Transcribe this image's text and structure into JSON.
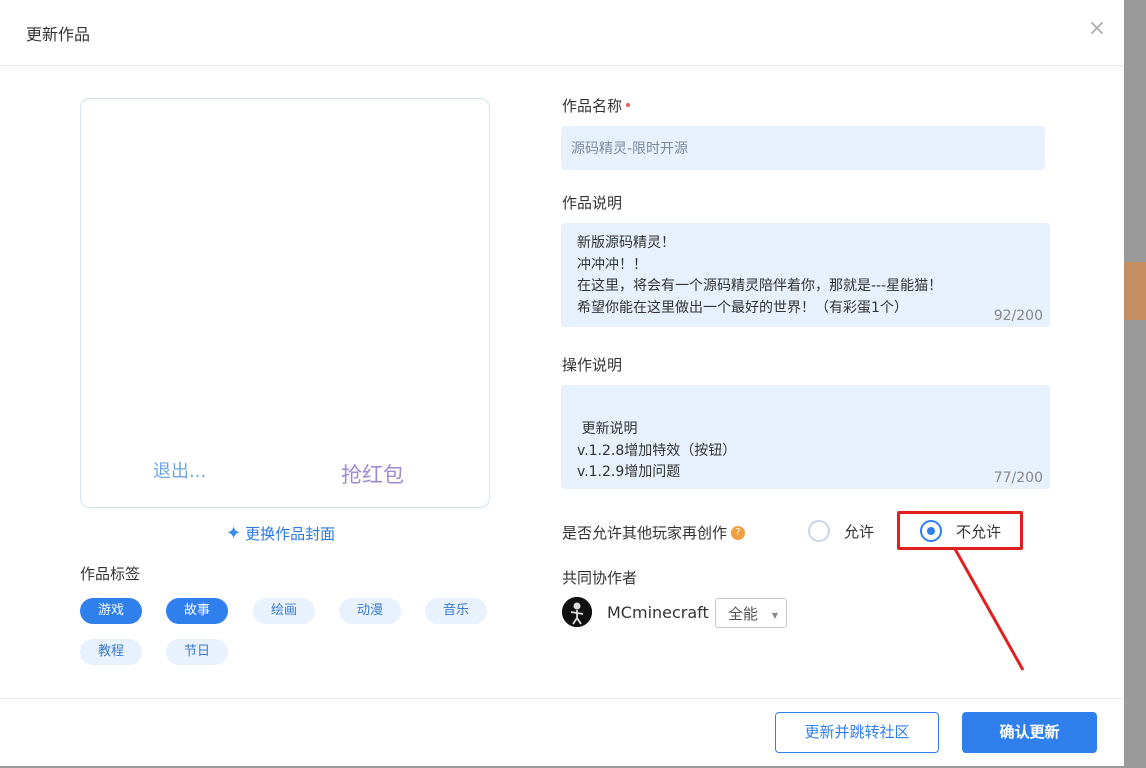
{
  "dialog": {
    "title": "更新作品",
    "close_glyph": "×"
  },
  "preview": {
    "exit_text": "退出...",
    "redpacket_text": "抢红包"
  },
  "change_cover_label": "更换作品封面",
  "tags": {
    "title": "作品标签",
    "items": [
      {
        "label": "游戏",
        "active": true
      },
      {
        "label": "故事",
        "active": true
      },
      {
        "label": "绘画",
        "active": false
      },
      {
        "label": "动漫",
        "active": false
      },
      {
        "label": "音乐",
        "active": false
      },
      {
        "label": "教程",
        "active": false
      },
      {
        "label": "节日",
        "active": false
      }
    ]
  },
  "form": {
    "name_label": "作品名称",
    "name_value": "源码精灵-限时开源",
    "description_label": "作品说明",
    "description_value": "新版源码精灵！\n冲冲冲！！\n在这里，将会有一个源码精灵陪伴着你，那就是---星能猫！\n希望你能在这里做出一个最好的世界！（有彩蛋1个）",
    "description_counter": "92/200",
    "ops_label": "操作说明",
    "ops_value": " 更新说明\nv.1.2.8增加特效（按钮）\nv.1.2.9增加问题",
    "ops_counter": "77/200",
    "remix_label": "是否允许其他玩家再创作",
    "remix_help_glyph": "?",
    "remix_options": [
      {
        "label": "允许",
        "checked": false
      },
      {
        "label": "不允许",
        "checked": true
      }
    ],
    "collaborators_label": "共同协作者",
    "collaborator": {
      "name": "MCminecraft",
      "role": "全能"
    }
  },
  "footer": {
    "update_and_jump_label": "更新并跳转社区",
    "confirm_label": "确认更新"
  },
  "colors": {
    "accent": "#2f80ed",
    "input_bg": "#e7f1fd",
    "annotation": "#e02020",
    "required": "#f15a5a"
  }
}
